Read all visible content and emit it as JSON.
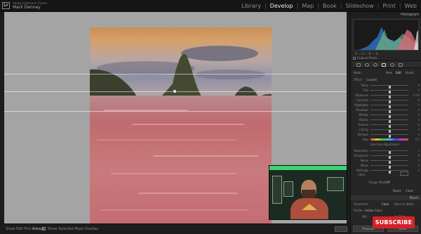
{
  "window": {
    "app_badge": "Lr",
    "app_title": "Adobe Lightroom Classic",
    "user_name": "Mark Denney"
  },
  "modules": {
    "library": "Library",
    "develop": "Develop",
    "map": "Map",
    "book": "Book",
    "slideshow": "Slideshow",
    "print": "Print",
    "web": "Web",
    "separator": "|"
  },
  "bottom_toolbar": {
    "show_edit_pins_label": "Show Edit Pins :",
    "show_edit_pins_value": "Always",
    "overlay_label": "Show Selected Mask Overlay"
  },
  "right_panel": {
    "histogram_title": "Histogram",
    "histogram_info": "R  ---  G  ---  B  ---  %",
    "original_photo_label": "Original Photo",
    "mask_label": "Mask :",
    "mask_new": "New",
    "mask_edit": "Edit",
    "mask_brush": "Brush",
    "effect_label": "Effect :",
    "effect_value": "Custom",
    "sliders": [
      {
        "label": "Temp",
        "value": "0"
      },
      {
        "label": "Tint",
        "value": "0"
      },
      {
        "label": "Exposure",
        "value": "0.00"
      },
      {
        "label": "Contrast",
        "value": "0"
      },
      {
        "label": "Highlights",
        "value": "0"
      },
      {
        "label": "Shadows",
        "value": "0"
      },
      {
        "label": "Whites",
        "value": "0"
      },
      {
        "label": "Blacks",
        "value": "0"
      },
      {
        "label": "Texture",
        "value": "0"
      },
      {
        "label": "Clarity",
        "value": "0"
      },
      {
        "label": "Dehaze",
        "value": "0"
      }
    ],
    "hue_label": "Hue",
    "hue_value": "0.0",
    "fine_adjust_label": "Use Fine Adjustment",
    "sliders_lower": [
      {
        "label": "Saturation",
        "value": "0"
      },
      {
        "label": "Sharpness",
        "value": "0"
      },
      {
        "label": "Noise",
        "value": "0"
      },
      {
        "label": "Moire",
        "value": "0"
      },
      {
        "label": "Defringe",
        "value": "0"
      }
    ],
    "color_label": "Color",
    "range_mask_label": "Range Mask :",
    "range_mask_value": "Off",
    "reset_label": "Reset",
    "close_label": "Close",
    "basic_title": "Basic",
    "treatment_label": "Treatment :",
    "treatment_color": "Color",
    "treatment_bw": "Black & White",
    "profile_label": "Profile :",
    "profile_value": "Adobe Color",
    "wb_label": "WB :",
    "wb_value": "As Shot",
    "previous_label": "Previous",
    "reset_bottom_label": "Reset"
  },
  "overlay": {
    "subscribe_label": "SUBSCRIBE"
  },
  "colors": {
    "accent_mask": "#c46a70",
    "subscribe_red": "#d4212a",
    "webcam_green": "#3bd474"
  }
}
